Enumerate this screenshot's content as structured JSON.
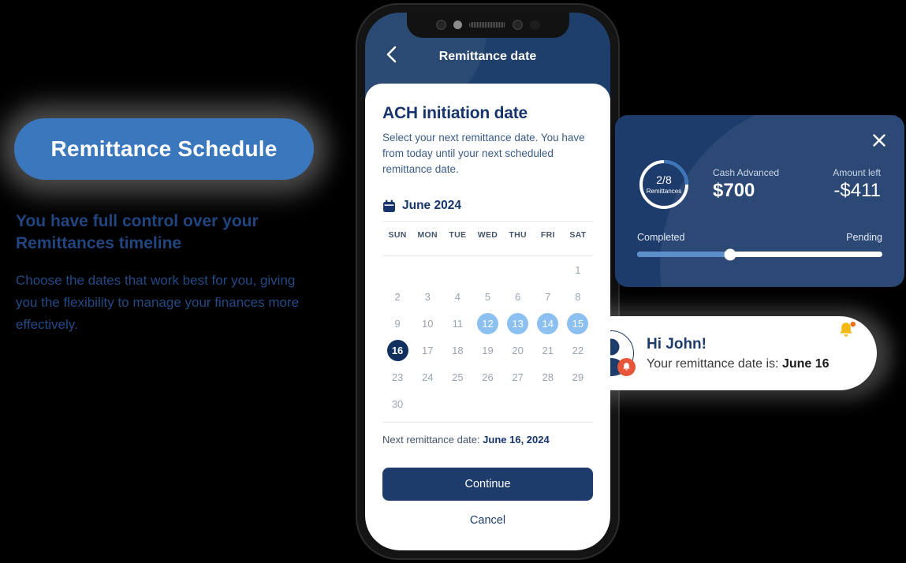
{
  "left_panel": {
    "pill_label": "Remittance Schedule",
    "heading": "You have full control over your Remittances timeline",
    "body": "Choose the dates that work best for you, giving you the flexibility to manage your finances more effectively."
  },
  "phone": {
    "app_bar": {
      "back_icon": "chevron-left-icon",
      "title": "Remittance date"
    },
    "sheet": {
      "title": "ACH initiation date",
      "description": "Select your next remittance date. You have from today until your next scheduled remittance date.",
      "calendar_icon": "calendar-icon",
      "month_label": "June 2024",
      "weekday_headers": [
        "SUN",
        "MON",
        "TUE",
        "WED",
        "THU",
        "FRI",
        "SAT"
      ],
      "leading_blanks": 6,
      "days": [
        1,
        2,
        3,
        4,
        5,
        6,
        7,
        8,
        9,
        10,
        11,
        12,
        13,
        14,
        15,
        16,
        17,
        18,
        19,
        20,
        21,
        22,
        23,
        24,
        25,
        26,
        27,
        28,
        29,
        30
      ],
      "range_days": [
        12,
        13,
        14,
        15
      ],
      "selected_day": 16,
      "next_remittance_prefix": "Next remittance date: ",
      "next_remittance_date": "June 16, 2024",
      "continue_label": "Continue",
      "cancel_label": "Cancel"
    }
  },
  "summary_card": {
    "close_icon": "close-icon",
    "ring": {
      "fraction": "2/8",
      "sublabel": "Remittances",
      "percent": 25
    },
    "cash_advanced_label": "Cash Advanced",
    "cash_advanced_value": "$700",
    "amount_left_label": "Amount left",
    "amount_left_value": "-$411",
    "slider": {
      "left_label": "Completed",
      "right_label": "Pending",
      "percent": 38
    }
  },
  "toast": {
    "avatar_icon": "user-avatar-icon",
    "avatar_badge_icon": "bell-icon",
    "title": "Hi John!",
    "body_prefix": "Your remittance date is: ",
    "body_date": "June 16",
    "bell_icon": "bell-icon"
  },
  "colors": {
    "brand_navy": "#1d3b6b",
    "brand_blue": "#3b77bd",
    "range_blue": "#8bc0f0",
    "selected_navy": "#12305e",
    "accent_orange": "#e8563a",
    "bell_yellow": "#f5b914"
  }
}
